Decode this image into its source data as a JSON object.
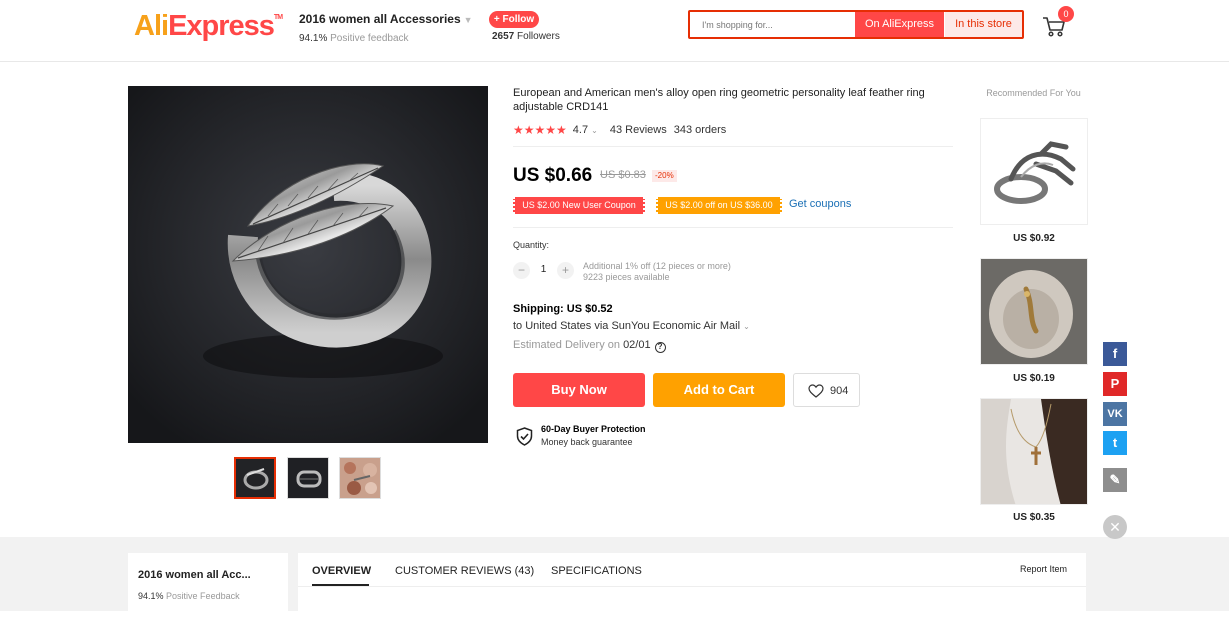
{
  "header": {
    "logo": "AliExpress",
    "store_name": "2016 women all Accessories",
    "positive_pct": "94.1%",
    "positive_label": "Positive feedback",
    "follow_label": "+ Follow",
    "followers_count": "2657",
    "followers_label": "Followers",
    "search_placeholder": "I'm shopping for...",
    "search_aliexpress": "On AliExpress",
    "search_store": "In this store",
    "cart_count": "0"
  },
  "product": {
    "title": "European and American men's alloy open ring geometric personality leaf feather ring adjustable CRD141",
    "rating": "4.7",
    "reviews": "43 Reviews",
    "orders": "343 orders",
    "price": "US $0.66",
    "original_price": "US $0.83",
    "discount": "-20%",
    "coupon_new_user": "US $2.00 New User Coupon",
    "coupon_off": "US $2.00 off on US $36.00",
    "get_coupons": "Get coupons",
    "quantity_label": "Quantity:",
    "quantity": "1",
    "qty_note_1": "Additional 1% off (12 pieces or more)",
    "qty_note_2": "9223 pieces available",
    "shipping": "Shipping: US $0.52",
    "ship_to": "to United States via SunYou Economic Air Mail",
    "delivery_label": "Estimated Delivery on",
    "delivery_date": "02/01",
    "buy_now": "Buy Now",
    "add_to_cart": "Add to Cart",
    "wishlist_count": "904",
    "protection_title": "60-Day Buyer Protection",
    "protection_sub": "Money back guarantee"
  },
  "recommended": {
    "title": "Recommended For You",
    "items": [
      {
        "price": "US $0.92"
      },
      {
        "price": "US $0.19"
      },
      {
        "price": "US $0.35"
      }
    ]
  },
  "social": [
    "facebook-icon",
    "pinterest-icon",
    "vk-icon",
    "twitter-icon",
    "edit-icon"
  ],
  "bottom": {
    "store_name": "2016 women all Acc...",
    "positive_pct": "94.1%",
    "positive_label": "Positive Feedback",
    "tabs": [
      "OVERVIEW",
      "CUSTOMER REVIEWS (43)",
      "SPECIFICATIONS"
    ],
    "report": "Report Item"
  },
  "colors": {
    "brand_red": "#ff4747",
    "brand_orange": "#ffa100",
    "link_blue": "#1a6fb5"
  }
}
